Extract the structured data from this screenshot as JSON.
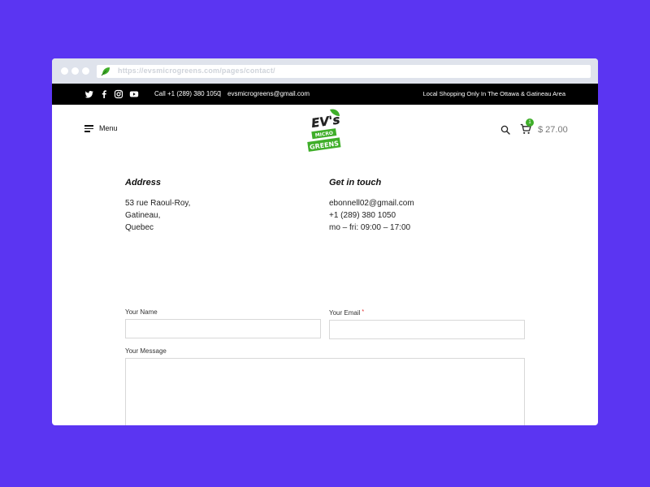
{
  "browser": {
    "url": "https://evsmicrogreens.com/pages/contact/"
  },
  "topbar": {
    "social_icons": [
      "twitter-icon",
      "facebook-icon",
      "instagram-icon",
      "youtube-icon"
    ],
    "phone": "Call +1 (289) 380 1050",
    "separator": "|",
    "email": "evsmicrogreens@gmail.com",
    "notice": "Local Shopping Only In The Ottawa & Gatineau Area"
  },
  "header": {
    "menu_label": "Menu",
    "logo": {
      "line1": "EV's",
      "line2": "MICRO",
      "line3": "GREENS"
    },
    "cart_count": "1",
    "cart_total": "$ 27.00"
  },
  "address": {
    "heading": "Address",
    "lines": [
      "53 rue Raoul-Roy,",
      "Gatineau,",
      "Quebec"
    ]
  },
  "contact": {
    "heading": "Get in touch",
    "lines": [
      "ebonnell02@gmail.com",
      "+1 (289) 380 1050",
      "mo – fri: 09:00 – 17:00"
    ]
  },
  "form": {
    "name_label": "Your Name",
    "email_label": "Your Email",
    "required_mark": "*",
    "message_label": "Your Message",
    "name_value": "",
    "email_value": "",
    "message_value": ""
  },
  "colors": {
    "background": "#5b35f2",
    "brand_green": "#3fae29",
    "topbar": "#000000"
  }
}
